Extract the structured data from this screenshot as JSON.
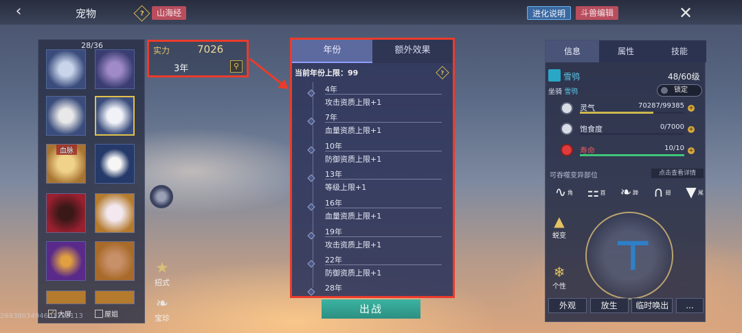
{
  "topbar": {
    "title": "宠物",
    "shanhai_tag": "山海经",
    "evolution_btn": "进化说明",
    "beast_edit_btn": "斗兽编辑"
  },
  "pet_list": {
    "count": "28/36",
    "pets": [
      {
        "label": "",
        "icon": "white-deer-icon",
        "selected": false
      },
      {
        "label": "",
        "icon": "purple-bird-icon",
        "selected": false
      },
      {
        "label": "",
        "icon": "white-eagle-icon",
        "selected": false
      },
      {
        "label": "",
        "icon": "white-bird-icon",
        "selected": true
      },
      {
        "label": "血脉",
        "icon": "golden-girl-icon",
        "selected": false
      },
      {
        "label": "",
        "icon": "white-ghost-icon",
        "selected": false
      },
      {
        "label": "",
        "icon": "red-wolf-icon",
        "selected": false
      },
      {
        "label": "",
        "icon": "pink-face-icon",
        "selected": false
      },
      {
        "label": "",
        "icon": "purple-bird-icon",
        "selected": false
      },
      {
        "label": "",
        "icon": "flower-mask-icon",
        "selected": false
      }
    ],
    "check_1": "大屏",
    "check_2": "屋姐"
  },
  "strength": {
    "label": "实力",
    "value": "7026",
    "year": "3年"
  },
  "year_panel": {
    "tabs": [
      {
        "label": "年份",
        "active": true
      },
      {
        "label": "额外效果",
        "active": false
      }
    ],
    "cap_label": "当前年份上限：99",
    "entries": [
      {
        "year": "4年",
        "desc": "攻击资质上限+1"
      },
      {
        "year": "7年",
        "desc": "血量资质上限+1"
      },
      {
        "year": "10年",
        "desc": "防御资质上限+1"
      },
      {
        "year": "13年",
        "desc": "等级上限+1"
      },
      {
        "year": "16年",
        "desc": "血量资质上限+1"
      },
      {
        "year": "19年",
        "desc": "攻击资质上限+1"
      },
      {
        "year": "22年",
        "desc": "防御资质上限+1"
      },
      {
        "year": "28年",
        "desc": ""
      }
    ],
    "battle_btn": "出战"
  },
  "side_icons": {
    "skill": "招式",
    "treasure": "宝珍"
  },
  "info_panel": {
    "tabs": [
      {
        "label": "信息",
        "active": true
      },
      {
        "label": "属性",
        "active": false
      },
      {
        "label": "技能",
        "active": false
      }
    ],
    "pet_name": "雪鸮",
    "level": "48/60级",
    "mount_label": "坐骑",
    "mount_name": "雪鸮",
    "lock_label": "锁定",
    "stats": [
      {
        "label": "灵气",
        "value": "70287/99385",
        "ratio": 0.707,
        "color": "#cdb84e"
      },
      {
        "label": "饱食度",
        "value": "0/7000",
        "ratio": 0.0,
        "color": "#cdb84e"
      },
      {
        "label": "寿命",
        "value": "10/10",
        "ratio": 1.0,
        "color": "#3fc77a"
      }
    ],
    "devour_label": "可吞噬变异部位",
    "detail_btn": "点击查看详情",
    "parts": [
      {
        "label": "角",
        "icon": "horn-icon"
      },
      {
        "label": "首",
        "icon": "head-icon"
      },
      {
        "label": "蹄",
        "icon": "hoof-icon"
      },
      {
        "label": "翅",
        "icon": "wing-icon"
      },
      {
        "label": "尾",
        "icon": "tail-icon"
      }
    ],
    "mutate_label": "蜕变",
    "trait_label": "个性",
    "buttons": [
      "外观",
      "放生",
      "临时唤出",
      "..."
    ]
  },
  "watermark": "2693803494601123113"
}
